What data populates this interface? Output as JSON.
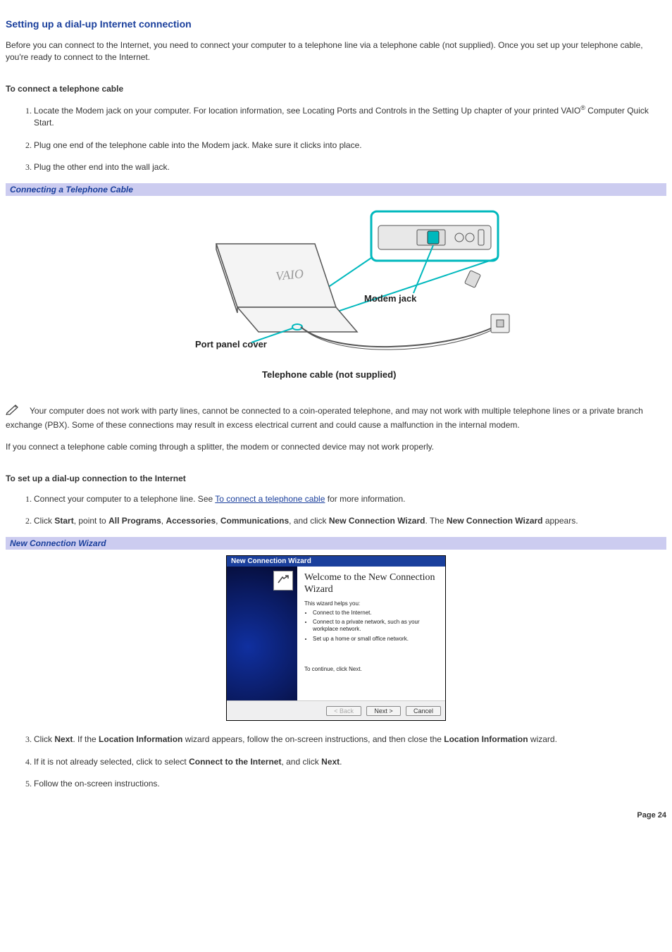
{
  "title": "Setting up a dial-up Internet connection",
  "intro": "Before you can connect to the Internet, you need to connect your computer to a telephone line via a telephone cable (not supplied). Once you set up your telephone cable, you're ready to connect to the Internet.",
  "section1": {
    "heading": "To connect a telephone cable",
    "steps": {
      "s1a": "Locate the Modem jack on your computer. For location information, see Locating Ports and Controls in the Setting Up chapter of your printed VAIO",
      "s1b": " Computer Quick Start.",
      "reg": "®",
      "s2": "Plug one end of the telephone cable into the Modem jack. Make sure it clicks into place.",
      "s3": "Plug the other end into the wall jack."
    }
  },
  "figure1": {
    "caption_bar": "Connecting a Telephone Cable",
    "label_modem": "Modem jack",
    "label_port": "Port panel cover",
    "label_cable": "Telephone cable (not supplied)"
  },
  "note1": "Your computer does not work with party lines, cannot be connected to a coin-operated telephone, and may not work with multiple telephone lines or a private branch exchange (PBX). Some of these connections may result in excess electrical current and could cause a malfunction in the internal modem.",
  "note2": "If you connect a telephone cable coming through a splitter, the modem or connected device may not work properly.",
  "section2": {
    "heading": "To set up a dial-up connection to the Internet",
    "s1a": "Connect your computer to a telephone line. See ",
    "s1link": "To connect a telephone cable",
    "s1b": " for more information.",
    "s2_plain1": "Click ",
    "s2_b1": "Start",
    "s2_plain2": ", point to ",
    "s2_b2": "All Programs",
    "s2_plain3": ", ",
    "s2_b3": "Accessories",
    "s2_plain4": ", ",
    "s2_b4": "Communications",
    "s2_plain5": ", and click ",
    "s2_b5": "New Connection Wizard",
    "s2_plain6": ". The ",
    "s2_b6": "New Connection Wizard",
    "s2_plain7": " appears.",
    "s3_plain1": "Click ",
    "s3_b1": "Next",
    "s3_plain2": ". If the ",
    "s3_b2": "Location Information",
    "s3_plain3": " wizard appears, follow the on-screen instructions, and then close the ",
    "s3_b3": "Location Information",
    "s3_plain4": " wizard.",
    "s4_plain1": "If it is not already selected, click to select ",
    "s4_b1": "Connect to the Internet",
    "s4_plain2": ", and click ",
    "s4_b2": "Next",
    "s4_plain3": ".",
    "s5": "Follow the on-screen instructions."
  },
  "figure2": {
    "caption_bar": "New Connection Wizard",
    "titlebar": "New Connection Wizard",
    "heading": "Welcome to the New Connection Wizard",
    "line1": "This wizard helps you:",
    "bullet1": "Connect to the Internet.",
    "bullet2": "Connect to a private network, such as your workplace network.",
    "bullet3": "Set up a home or small office network.",
    "continue": "To continue, click Next.",
    "btn_back": "< Back",
    "btn_next": "Next >",
    "btn_cancel": "Cancel"
  },
  "page_number": "Page 24"
}
